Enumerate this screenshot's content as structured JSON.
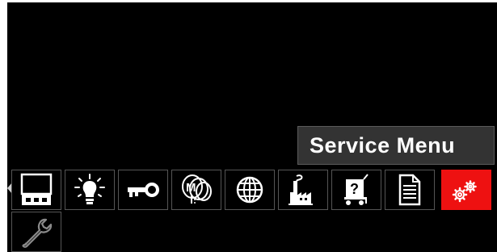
{
  "tooltip": {
    "label": "Service Menu"
  },
  "menu": {
    "selected": "service-menu",
    "accent_color": "#ee1111",
    "row1": [
      {
        "id": "display",
        "icon": "display-icon"
      },
      {
        "id": "brightness",
        "icon": "lightbulb-icon"
      },
      {
        "id": "lock",
        "icon": "key-icon"
      },
      {
        "id": "process",
        "icon": "wire-spools-icon"
      },
      {
        "id": "language",
        "icon": "globe-icon"
      },
      {
        "id": "factory-reset",
        "icon": "factory-icon"
      },
      {
        "id": "help",
        "icon": "question-cart-icon"
      },
      {
        "id": "information",
        "icon": "document-icon"
      },
      {
        "id": "service-menu",
        "icon": "gears-icon"
      }
    ],
    "row2": [
      {
        "id": "tools",
        "icon": "wrench-icon"
      }
    ]
  }
}
